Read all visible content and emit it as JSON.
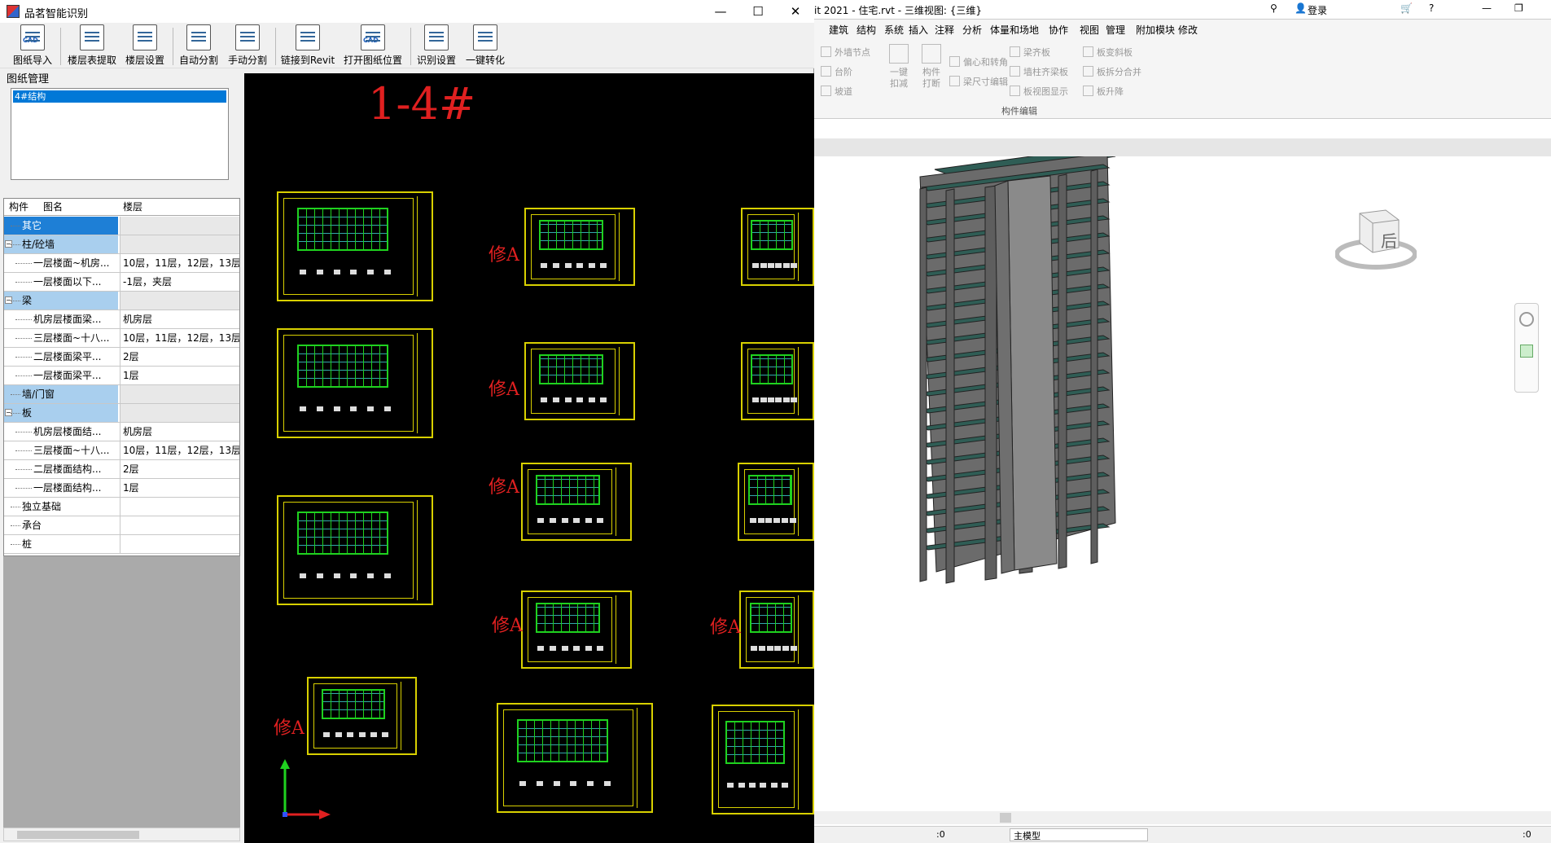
{
  "app": {
    "title": "品茗智能识别",
    "window_controls": {
      "minimize": "—",
      "maximize": "☐",
      "close": "✕"
    }
  },
  "toolbar": {
    "items": [
      {
        "label": "图纸导入",
        "badge": "CAD"
      },
      {
        "label": "楼层表提取",
        "badge": ""
      },
      {
        "label": "楼层设置",
        "badge": ""
      },
      {
        "label": "自动分割",
        "badge": ""
      },
      {
        "label": "手动分割",
        "badge": ""
      },
      {
        "label": "链接到Revit",
        "badge": ""
      },
      {
        "label": "打开图纸位置",
        "badge": "CAD"
      },
      {
        "label": "识别设置",
        "badge": ""
      },
      {
        "label": "一键转化",
        "badge": ""
      }
    ]
  },
  "drawing_manager": {
    "label": "图纸管理",
    "items": [
      "4#结构"
    ]
  },
  "tree": {
    "headers": {
      "component": "构件",
      "name": "图名",
      "floor": "楼层"
    },
    "rows": [
      {
        "name": "其它",
        "floor": "",
        "level": 0,
        "type": "cat-sel"
      },
      {
        "name": "柱/砼墙",
        "floor": "",
        "level": 0,
        "type": "cat",
        "toggle": "−"
      },
      {
        "name": "一层楼面~机房...",
        "floor": "10层，11层，12层，13层，...",
        "level": 1,
        "type": "leaf"
      },
      {
        "name": "一层楼面以下...",
        "floor": "-1层，夹层",
        "level": 1,
        "type": "leaf"
      },
      {
        "name": "梁",
        "floor": "",
        "level": 0,
        "type": "cat",
        "toggle": "−"
      },
      {
        "name": "机房层楼面梁...",
        "floor": "机房层",
        "level": 1,
        "type": "leaf"
      },
      {
        "name": "三层楼面~十八...",
        "floor": "10层，11层，12层，13层，...",
        "level": 1,
        "type": "leaf"
      },
      {
        "name": "二层楼面梁平...",
        "floor": "2层",
        "level": 1,
        "type": "leaf"
      },
      {
        "name": "一层楼面梁平...",
        "floor": "1层",
        "level": 1,
        "type": "leaf"
      },
      {
        "name": "墙/门窗",
        "floor": "",
        "level": 0,
        "type": "cat"
      },
      {
        "name": "板",
        "floor": "",
        "level": 0,
        "type": "cat",
        "toggle": "−"
      },
      {
        "name": "机房层楼面结...",
        "floor": "机房层",
        "level": 1,
        "type": "leaf"
      },
      {
        "name": "三层楼面~十八...",
        "floor": "10层，11层，12层，13层，...",
        "level": 1,
        "type": "leaf"
      },
      {
        "name": "二层楼面结构...",
        "floor": "2层",
        "level": 1,
        "type": "leaf"
      },
      {
        "name": "一层楼面结构...",
        "floor": "1层",
        "level": 1,
        "type": "leaf"
      },
      {
        "name": "独立基础",
        "floor": "",
        "level": 0,
        "type": "plain"
      },
      {
        "name": "承台",
        "floor": "",
        "level": 0,
        "type": "plain"
      },
      {
        "name": "桩",
        "floor": "",
        "level": 0,
        "type": "plain"
      }
    ]
  },
  "cad": {
    "title": "1-4#",
    "revision_mark": "修A"
  },
  "revit": {
    "title": "it 2021 - 住宅.rvt - 三维视图: {三维}",
    "login": "登录",
    "menu": [
      "建筑",
      "结构",
      "系统",
      "插入",
      "注释",
      "分析",
      "体量和场地",
      "协作",
      "视图",
      "管理",
      "附加模块",
      "修改"
    ],
    "ribbon": {
      "col1": [
        "外墙节点",
        "台阶",
        "坡道"
      ],
      "big1": "一键扣减",
      "big2": "构件打断",
      "col2": [
        "偏心和转角",
        "梁尺寸编辑"
      ],
      "col3": [
        "梁齐板",
        "墙柱齐梁板",
        "板视图显示"
      ],
      "col4": [
        "板变斜板",
        "板拆分合并",
        "板升降"
      ],
      "group": "构件编辑"
    },
    "viewcube": "后",
    "status": {
      "coord": ":0",
      "model": "主模型",
      "filter": ":0"
    }
  }
}
